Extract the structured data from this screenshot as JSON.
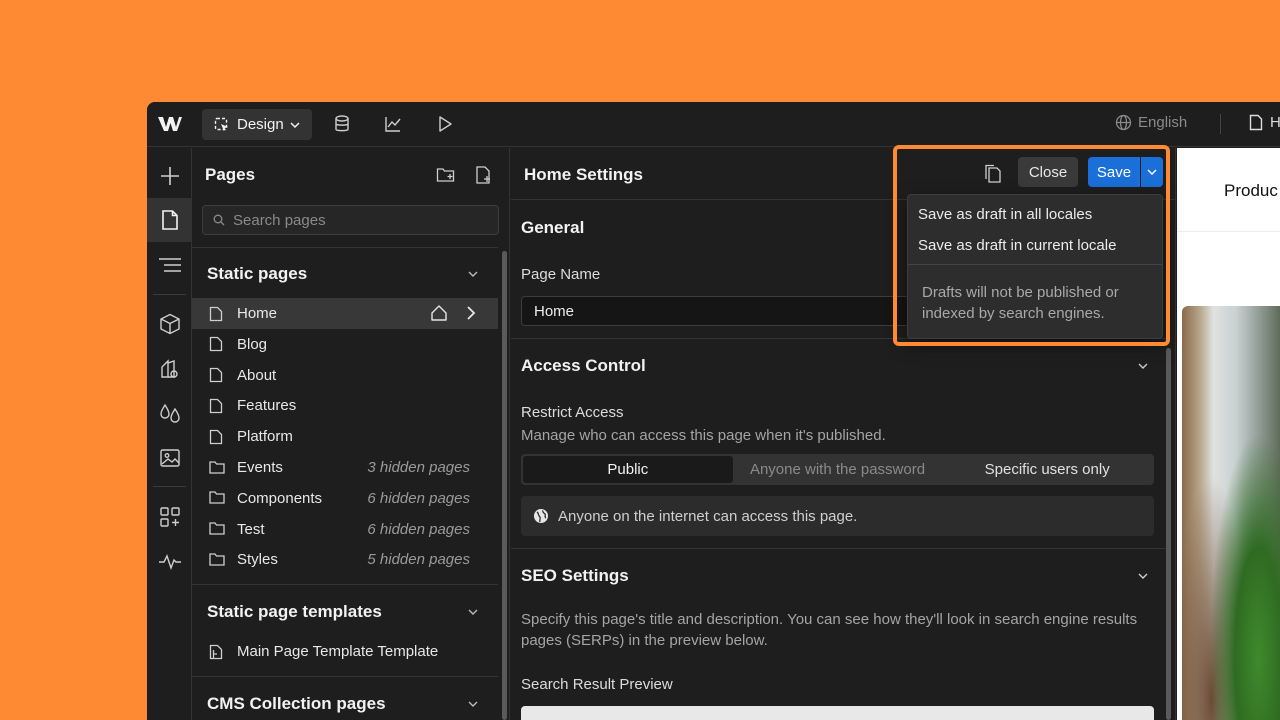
{
  "topbar": {
    "mode_label": "Design",
    "language": "English",
    "page_indicator": "H"
  },
  "pages_panel": {
    "title": "Pages",
    "search_placeholder": "Search pages",
    "static_pages": {
      "heading": "Static pages",
      "items": [
        {
          "label": "Home",
          "icon": "page-icon",
          "hidden": ""
        },
        {
          "label": "Blog",
          "icon": "page-icon",
          "hidden": ""
        },
        {
          "label": "About",
          "icon": "page-icon",
          "hidden": ""
        },
        {
          "label": "Features",
          "icon": "page-icon",
          "hidden": ""
        },
        {
          "label": "Platform",
          "icon": "page-icon",
          "hidden": ""
        },
        {
          "label": "Events",
          "icon": "folder-icon",
          "hidden": "3 hidden pages"
        },
        {
          "label": "Components",
          "icon": "folder-icon",
          "hidden": "6 hidden pages"
        },
        {
          "label": "Test",
          "icon": "folder-icon",
          "hidden": "6 hidden pages"
        },
        {
          "label": "Styles",
          "icon": "folder-icon",
          "hidden": "5 hidden pages"
        }
      ]
    },
    "templates": {
      "heading": "Static page templates",
      "items": [
        {
          "label": "Main Page Template Template",
          "icon": "template-icon"
        }
      ]
    },
    "cms": {
      "heading": "CMS Collection pages"
    }
  },
  "settings": {
    "title": "Home Settings",
    "close_label": "Close",
    "save_label": "Save",
    "general": {
      "heading": "General",
      "page_name_label": "Page Name",
      "page_name_value": "Home"
    },
    "access": {
      "heading": "Access Control",
      "restrict_label": "Restrict Access",
      "restrict_desc": "Manage who can access this page when it's published.",
      "options": [
        "Public",
        "Anyone with the password",
        "Specific users only"
      ],
      "selected": "Public",
      "notice": "Anyone on the internet can access this page."
    },
    "seo": {
      "heading": "SEO Settings",
      "desc": "Specify this page's title and description. You can see how they'll look in search engine results pages (SERPs) in the preview below.",
      "preview_label": "Search Result Preview"
    }
  },
  "save_menu": {
    "items": [
      "Save as draft in all locales",
      "Save as draft in current locale"
    ],
    "note": "Drafts will not be published or indexed by search engines."
  },
  "preview": {
    "nav_text": "Produc"
  },
  "colors": {
    "accent": "#ff8a34",
    "primary": "#1a6fd8",
    "background": "#1e1e1e"
  }
}
